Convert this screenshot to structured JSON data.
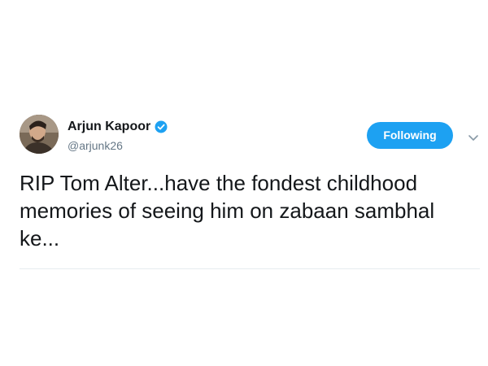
{
  "tweet": {
    "display_name": "Arjun Kapoor",
    "handle": "@arjunk26",
    "verified": true,
    "follow_button_label": "Following",
    "menu_icon": "chevron-down-icon",
    "text_lines": [
      "RIP Tom Alter...have the fondest childhood",
      "memories of seeing him on zabaan sambhal",
      "ke..."
    ]
  },
  "colors": {
    "accent": "#1da1f2",
    "text": "#14171a",
    "secondary_text": "#657786",
    "divider": "#e6ecf0"
  }
}
